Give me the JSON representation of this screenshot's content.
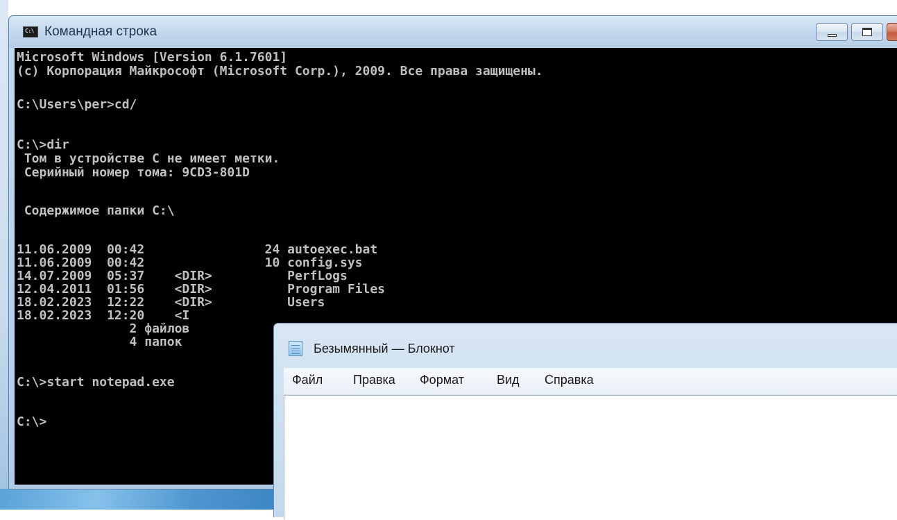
{
  "cmd": {
    "title": "Командная строка",
    "icon": "console-icon",
    "icon_label": "C:\\",
    "lines": [
      "Microsoft Windows [Version 6.1.7601]",
      "(c) Корпорация Майкрософт (Microsoft Corp.), 2009. Все права защищены.",
      "C:\\Users\\per>cd/",
      "C:\\>dir",
      " Том в устройстве C не имеет метки.",
      " Серийный номер тома: 9CD3-801D",
      " Содержимое папки C:\\",
      "11.06.2009  00:42                24 autoexec.bat",
      "11.06.2009  00:42                10 config.sys",
      "14.07.2009  05:37    <DIR>          PerfLogs",
      "12.04.2011  01:56    <DIR>          Program Files",
      "18.02.2023  12:22    <DIR>          Users",
      "18.02.2023  12:20    <I",
      "               2 файлов",
      "               4 папок",
      "C:\\>start notepad.exe",
      "C:\\>"
    ]
  },
  "notepad": {
    "title": "Безымянный — Блокнот",
    "icon": "notepad-icon",
    "menu": {
      "file": "Файл",
      "edit": "Правка",
      "format": "Формат",
      "view": "Вид",
      "help": "Справка"
    },
    "text": ""
  },
  "colors": {
    "console_bg": "#000000",
    "console_text": "#c0c0c0",
    "titlebar": "#c4d8ed",
    "close_button": "#c3573c"
  }
}
